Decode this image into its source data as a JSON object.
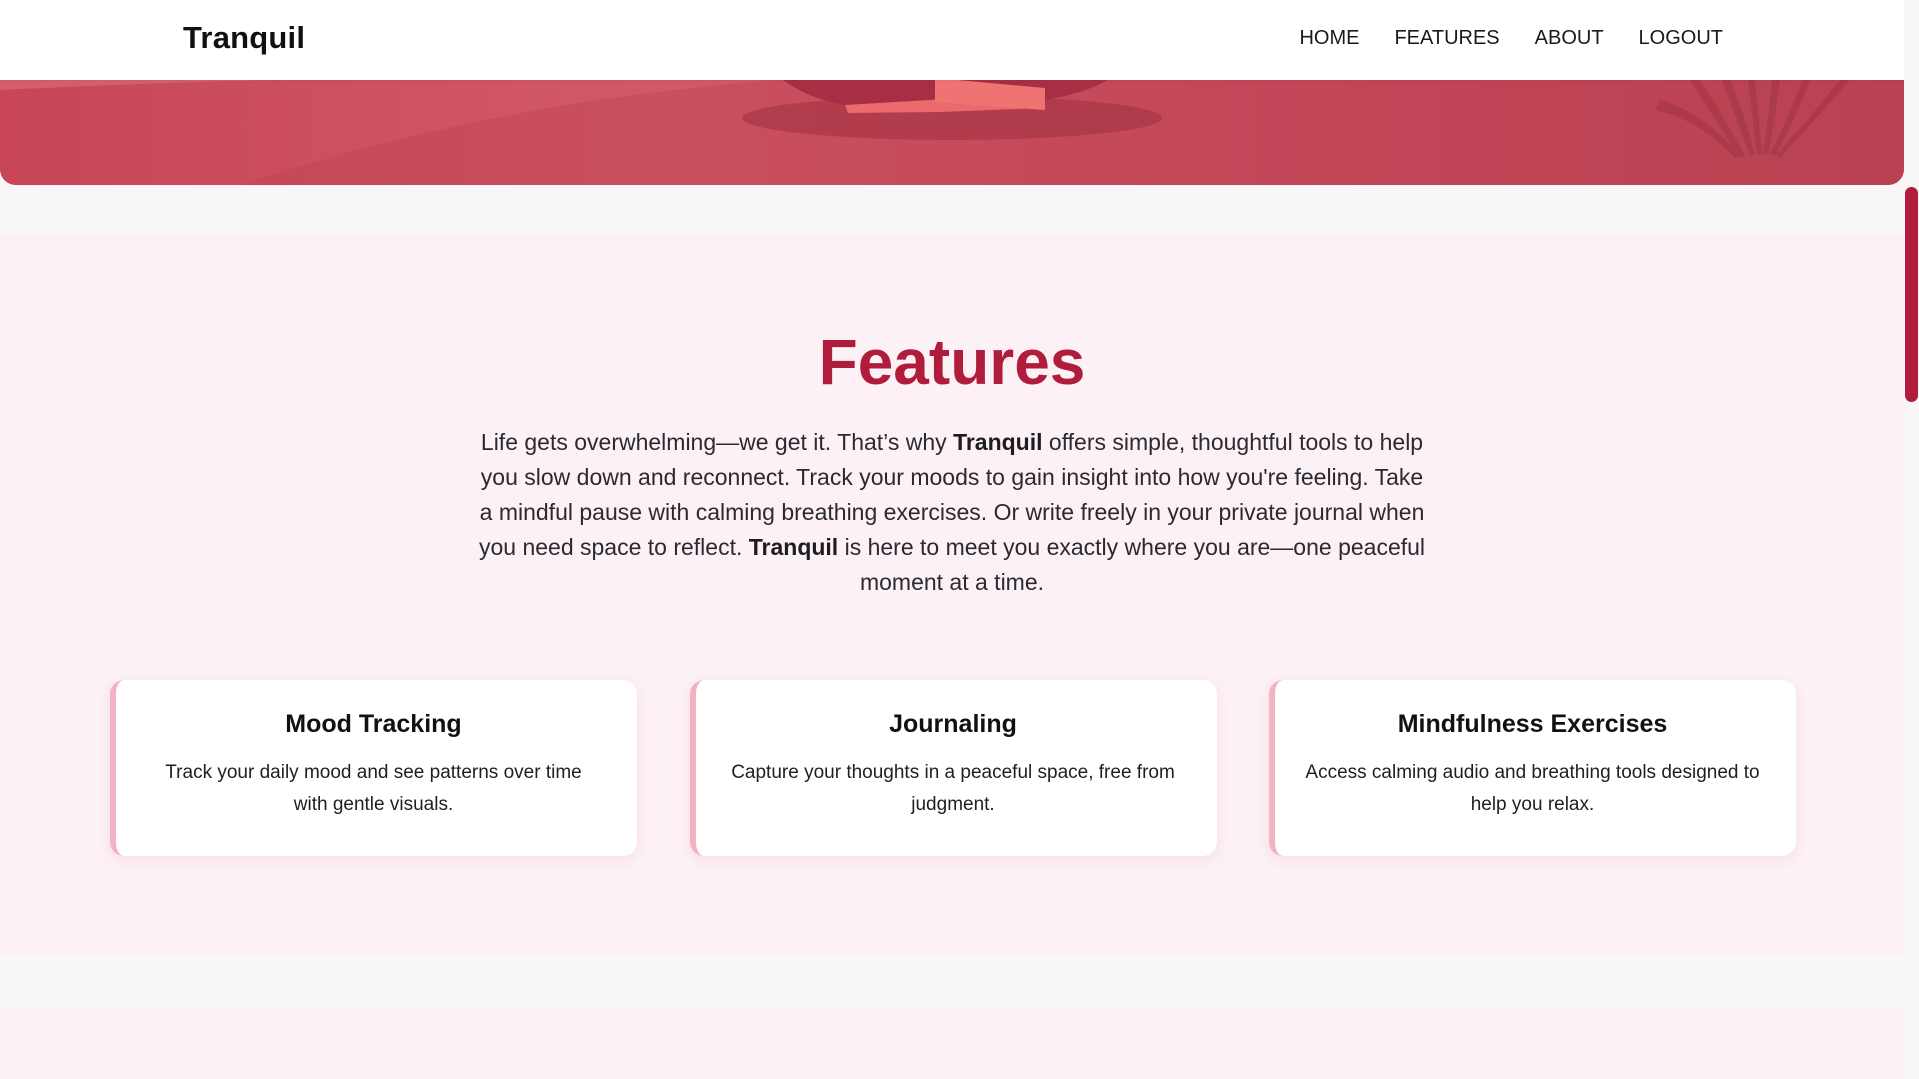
{
  "nav": {
    "brand": "Tranquil",
    "links": [
      "HOME",
      "FEATURES",
      "ABOUT",
      "LOGOUT"
    ]
  },
  "features": {
    "title": "Features",
    "desc": {
      "p1": "Life gets overwhelming—we get it. That’s why ",
      "brand1": "Tranquil",
      "p2": " offers simple, thoughtful tools to help you slow down and reconnect. Track your moods to gain insight into how you're feeling. Take a mindful pause with calming breathing exercises. Or write freely in your private journal when you need space to reflect. ",
      "brand2": "Tranquil",
      "p3": " is here to meet you exactly where you are—one peaceful moment at a time."
    },
    "cards": [
      {
        "title": "Mood Tracking",
        "text": "Track your daily mood and see patterns over time with gentle visuals."
      },
      {
        "title": "Journaling",
        "text": "Capture your thoughts in a peaceful space, free from judgment."
      },
      {
        "title": "Mindfulness Exercises",
        "text": "Access calming audio and breathing tools designed to help you relax."
      }
    ]
  },
  "colors": {
    "accent": "#b01c3c",
    "hero": "#c84a5a",
    "card_border": "#f4b3c2",
    "section_bg": "#fcf1f4"
  },
  "icons": {
    "hero_illustration": "meditation-illustration"
  }
}
